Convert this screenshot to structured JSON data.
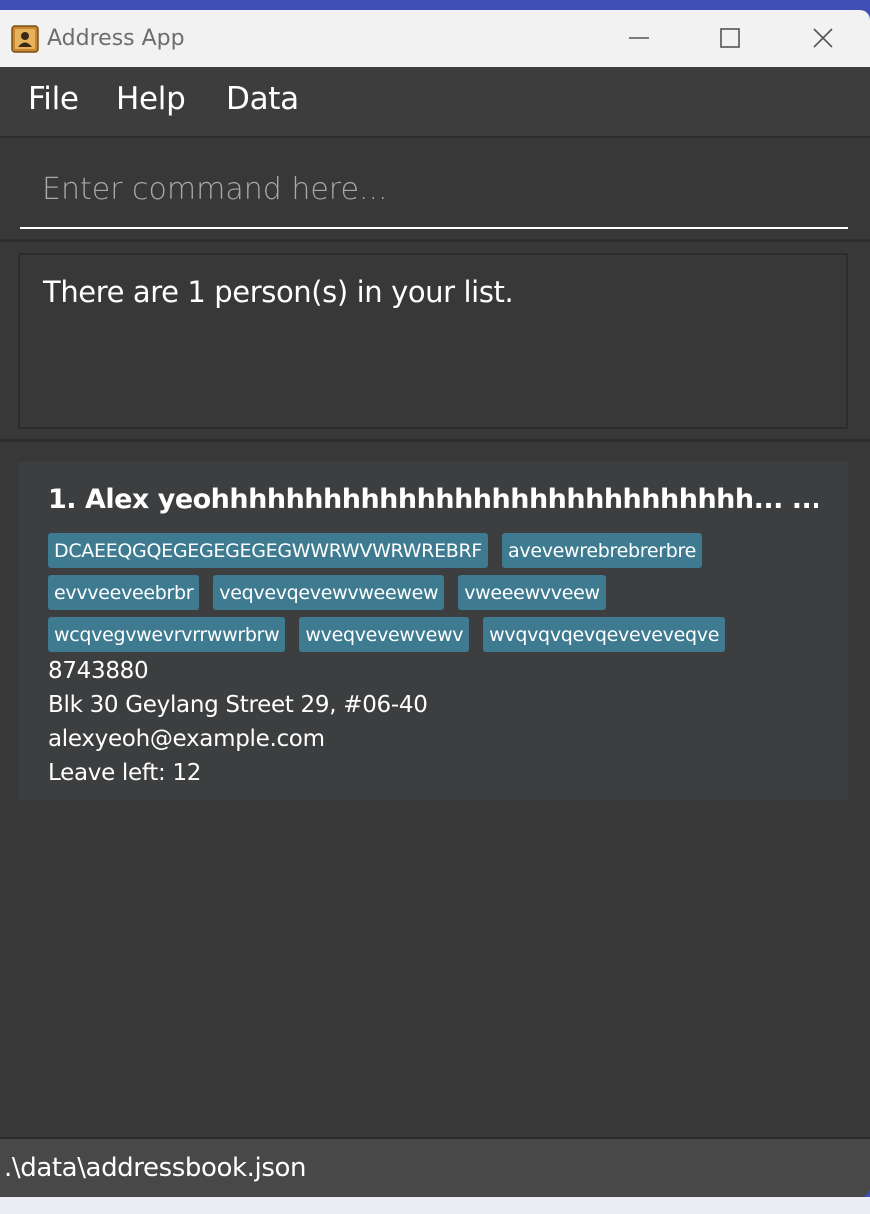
{
  "window": {
    "title": "Address App",
    "app_icon": "address-book-icon"
  },
  "menu": {
    "items": [
      {
        "label": "File"
      },
      {
        "label": "Help"
      },
      {
        "label": "Data"
      }
    ]
  },
  "command": {
    "placeholder": "Enter command here...",
    "value": ""
  },
  "result": {
    "message": "There are 1 person(s) in your list."
  },
  "persons": [
    {
      "index": "1.",
      "name": "1. Alex yeohhhhhhhhhhhhhhhhhhhhhhhhhhhhh...  ...",
      "tags": [
        "DCAEEQGQEGEGEGEGEGWWRWVWRWREBRF",
        "avevewrebrebrerbre",
        "evvveeveebrbr",
        "veqvevqevewvweewew",
        "vweeewvveew",
        "wcqvegvwevrvrrwwrbrw",
        "wveqvevewvewv",
        "wvqvqvqevqeveveveqve"
      ],
      "phone": "8743880",
      "address": "Blk 30 Geylang Street 29, #06-40",
      "email": "alexyeoh@example.com",
      "leave": "Leave left: 12"
    }
  ],
  "status": {
    "path": ".\\data\\addressbook.json"
  },
  "colors": {
    "background": "#383838",
    "tag": "#3e7b91",
    "titlebar": "#f2f2f2"
  }
}
